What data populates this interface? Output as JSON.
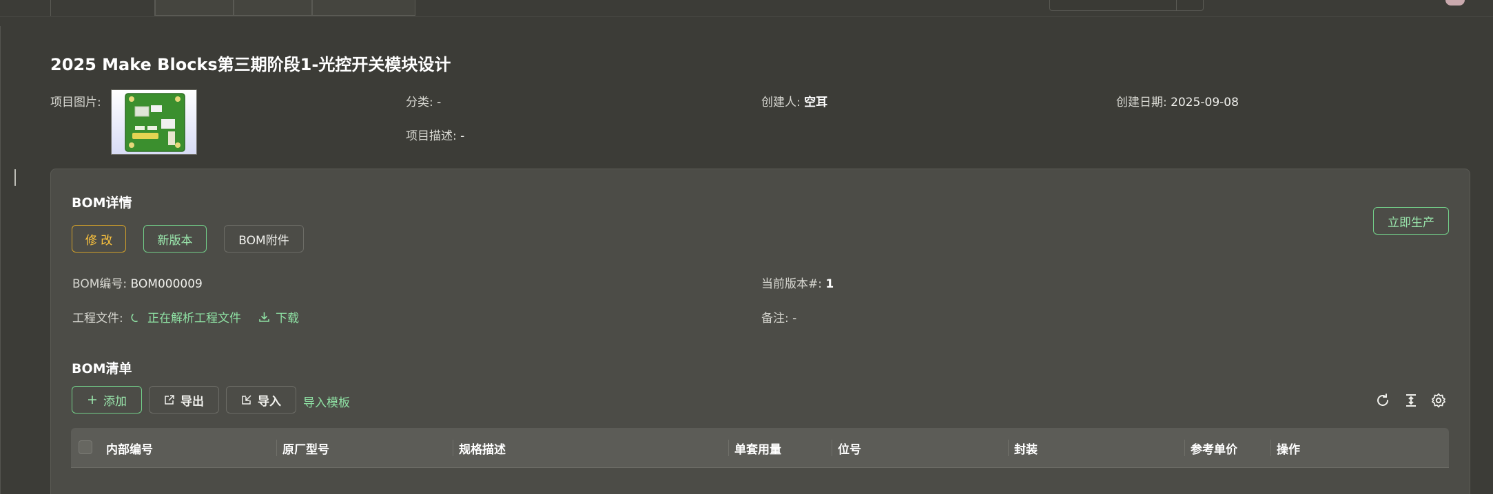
{
  "project": {
    "title": "2025 Make Blocks第三期阶段1-光控开关模块设计",
    "image_label": "项目图片:",
    "category_label": "分类:",
    "category_value": "-",
    "creator_label": "创建人:",
    "creator_value": "空耳",
    "created_label": "创建日期:",
    "created_value": "2025-09-08",
    "desc_label": "项目描述:",
    "desc_value": "-"
  },
  "bom": {
    "title": "BOM详情",
    "edit_label": "修 改",
    "new_version_label": "新版本",
    "attachments_label": "BOM附件",
    "produce_label": "立即生产",
    "number_label": "BOM编号:",
    "number_value": "BOM000009",
    "version_label": "当前版本#:",
    "version_value": "1",
    "files_label": "工程文件:",
    "parsing_label": "正在解析工程文件",
    "download_label": "下载",
    "remark_label": "备注:",
    "remark_value": "-"
  },
  "bom_list": {
    "title": "BOM清单",
    "add_label": "添加",
    "export_label": "导出",
    "import_label": "导入",
    "template_label": "导入模板",
    "columns": [
      "内部编号",
      "原厂型号",
      "规格描述",
      "单套用量",
      "位号",
      "封装",
      "参考单价",
      "操作"
    ]
  },
  "icons": {
    "toolbar": [
      "refresh-icon",
      "column-height-icon",
      "settings-icon"
    ],
    "buttons": [
      "plus-icon",
      "export-icon",
      "import-icon",
      "download-icon",
      "loading-icon"
    ]
  },
  "colors": {
    "background": "#3c3c37",
    "card": "#4c4c47",
    "accent_green": "#73d08a",
    "warning": "#ffc53d"
  }
}
